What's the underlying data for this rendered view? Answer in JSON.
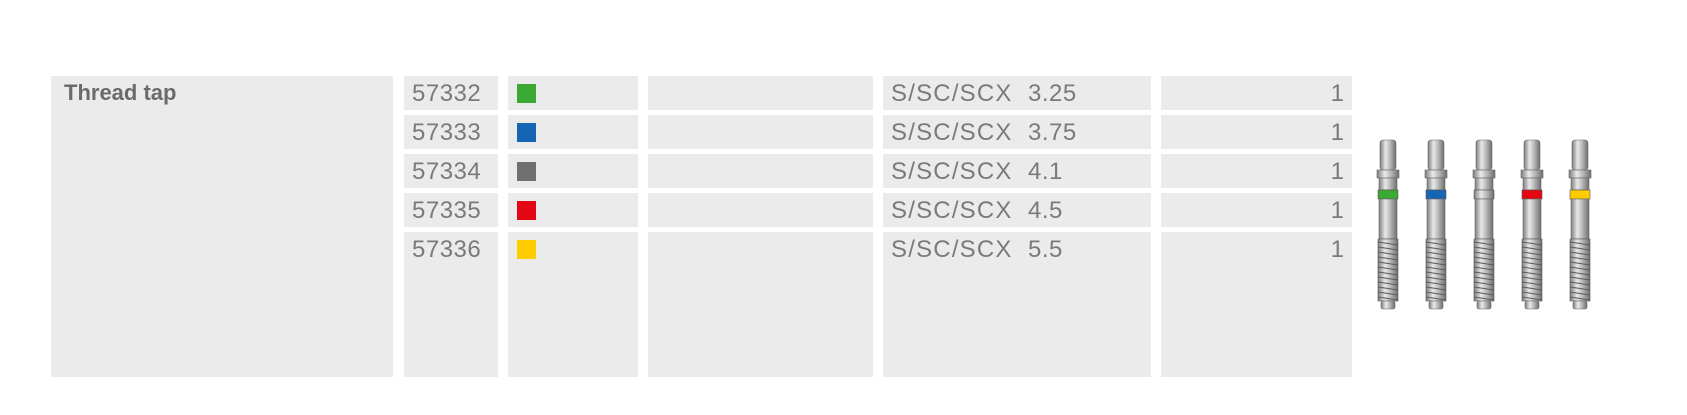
{
  "product": {
    "title": "Thread tap"
  },
  "rows": [
    {
      "article": "57332",
      "color": "#3aaa35",
      "system": "S/SC/SCX",
      "size": "3.25",
      "qty": "1"
    },
    {
      "article": "57333",
      "color": "#1565b4",
      "system": "S/SC/SCX",
      "size": "3.75",
      "qty": "1"
    },
    {
      "article": "57334",
      "color": "#707070",
      "system": "S/SC/SCX",
      "size": "4.1",
      "qty": "1"
    },
    {
      "article": "57335",
      "color": "#e30613",
      "system": "S/SC/SCX",
      "size": "4.5",
      "qty": "1"
    },
    {
      "article": "57336",
      "color": "#ffcc00",
      "system": "S/SC/SCX",
      "size": "5.5",
      "qty": "1"
    }
  ],
  "image": {
    "description_icon": "thread-tap-set-icon"
  }
}
